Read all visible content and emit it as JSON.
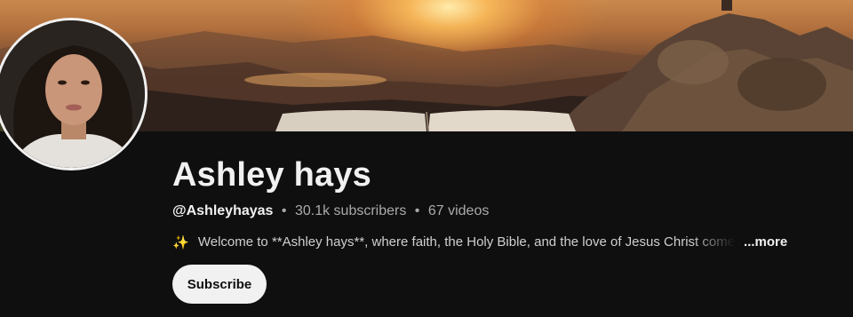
{
  "channel": {
    "name": "Ashley hays",
    "handle": "@Ashleyhayas",
    "subscribers": "30.1k subscribers",
    "videos": "67 videos",
    "separator": "•",
    "description_icon": "✨",
    "description": "Welcome to **Ashley hays**, where faith, the Holy Bible, and the love of Jesus Christ come",
    "more_label": "...more"
  },
  "actions": {
    "subscribe_label": "Subscribe"
  },
  "colors": {
    "background": "#0f0f0f",
    "text_primary": "#f1f1f1",
    "text_secondary": "#aaaaaa",
    "subscribe_bg": "#f1f1f1",
    "subscribe_text": "#0f0f0f"
  },
  "icons": {
    "description_icon": "sparkles-icon"
  }
}
